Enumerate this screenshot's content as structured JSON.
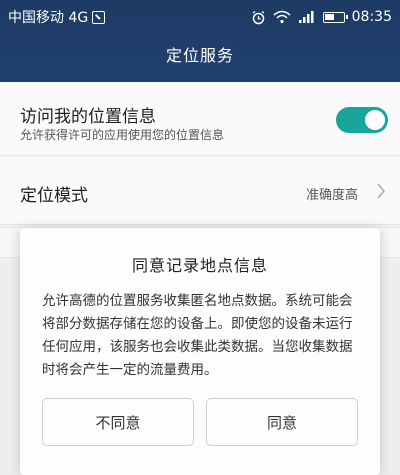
{
  "status_bar": {
    "carrier": "中国移动 4G",
    "time": "08:35",
    "icons": [
      "sim-icon",
      "alarm-icon",
      "wifi-icon",
      "signal-icon",
      "battery-icon"
    ]
  },
  "header": {
    "title": "定位服务"
  },
  "settings": {
    "access_location": {
      "label": "访问我的位置信息",
      "description": "允许获得许可的应用使用您的位置信息",
      "toggle_on": true
    },
    "location_mode": {
      "label": "定位模式",
      "value": "准确度高"
    }
  },
  "dialog": {
    "title": "同意记录地点信息",
    "body": "允许高德的位置服务收集匿名地点数据。系统可能会将部分数据存储在您的设备上。即使您的设备未运行任何应用，该服务也会收集此类数据。当您收集数据时将会产生一定的流量费用。",
    "disagree_label": "不同意",
    "agree_label": "同意"
  },
  "colors": {
    "header_bg": "#1f3d69",
    "toggle_on": "#18a59a",
    "page_bg": "#f2f2f2"
  }
}
